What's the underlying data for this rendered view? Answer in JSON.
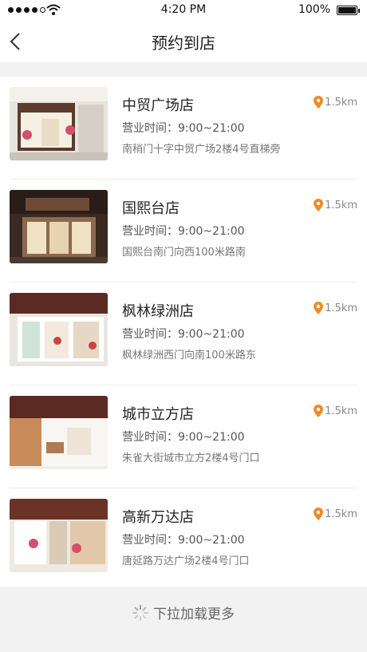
{
  "status_bar": {
    "time": "4:20 PM",
    "battery_percent": "100%",
    "signal_dots_filled": 4,
    "signal_dots_total": 5
  },
  "nav": {
    "title": "预约到店",
    "back_icon": "chevron-left-icon"
  },
  "stores": [
    {
      "name": "中贸广场店",
      "distance": "1.5km",
      "hours": "营业时间：9:00~21:00",
      "address": "南稍门十字中贸广场2楼4号直梯旁"
    },
    {
      "name": "国熙台店",
      "distance": "1.5km",
      "hours": "营业时间：9:00~21:00",
      "address": "国熙台南门向西100米路南"
    },
    {
      "name": "枫林绿洲店",
      "distance": "1.5km",
      "hours": "营业时间：9:00~21:00",
      "address": "枫林绿洲西门向南100米路东"
    },
    {
      "name": "城市立方店",
      "distance": "1.5km",
      "hours": "营业时间：9:00~21:00",
      "address": "朱雀大街城市立方2楼4号门口"
    },
    {
      "name": "高新万达店",
      "distance": "1.5km",
      "hours": "营业时间：9:00~21:00",
      "address": "唐延路万达广场2楼4号门口"
    }
  ],
  "footer": {
    "load_more": "下拉加载更多"
  },
  "colors": {
    "accent": "#f08a24",
    "band": "#f2f2f2"
  }
}
